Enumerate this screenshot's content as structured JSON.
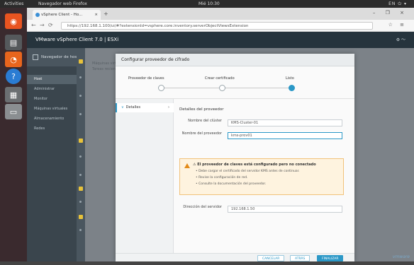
{
  "os": {
    "activities": "Activities",
    "app_name": "Navegador web Firefox",
    "clock": "Mié 10:30",
    "tray": "EN ⏻ ▾"
  },
  "browser": {
    "tab_title": "vSphere Client - Ho...",
    "tab_close": "×",
    "new_tab": "+",
    "window_controls": "– ❐ ×",
    "back": "←",
    "forward": "→",
    "reload": "⟳",
    "url": "https://192.168.1.100/ui/#?extensionId=vsphere.core.inventory.serverObjectViewsExtension",
    "menu": "☆ ≡"
  },
  "vsphere": {
    "title": "VMware vSphere Client 7.0 | ESXi",
    "user": "⚙ 〜"
  },
  "navigator": {
    "title": "Navegador de host",
    "items": [
      {
        "label": "Host",
        "active": true
      },
      {
        "label": "Administrar",
        "active": false
      },
      {
        "label": "Monitor",
        "active": false
      },
      {
        "label": "Máquinas virtuales",
        "active": false
      },
      {
        "label": "Almacenamiento",
        "active": false
      },
      {
        "label": "Redes",
        "active": false
      }
    ],
    "background_text": [
      "Máquinas virtuales",
      "Tareas recientes"
    ]
  },
  "dialog": {
    "title": "Configurar proveedor de cifrado",
    "steps": [
      {
        "label": "Proveedor de claves",
        "state": "done"
      },
      {
        "label": "Crear certificado",
        "state": "done"
      },
      {
        "label": "Listo",
        "state": "current"
      }
    ],
    "left_nav": {
      "caret": "∨",
      "label": "Detalles",
      "chevron": "›"
    },
    "section_title": "Detalles del proveedor",
    "fields": [
      {
        "label": "Nombre del clúster",
        "value": "KMS-Cluster-01"
      },
      {
        "label": "Nombre del proveedor",
        "value": "kms-prov01"
      },
      {
        "label": "Dirección del servidor",
        "value": "192.168.1.50"
      }
    ],
    "warning": {
      "title": "⚠ El proveedor de claves está configurado pero no conectado",
      "lines": [
        "• Debe cargar el certificado del servidor KMS antes de continuar.",
        "• Revise la configuración de red.",
        "• Consulte la documentación del proveedor."
      ]
    },
    "buttons": {
      "cancel": "CANCELAR",
      "back": "ATRÁS",
      "finish": "FINALIZAR"
    }
  },
  "watermark": "vmware"
}
